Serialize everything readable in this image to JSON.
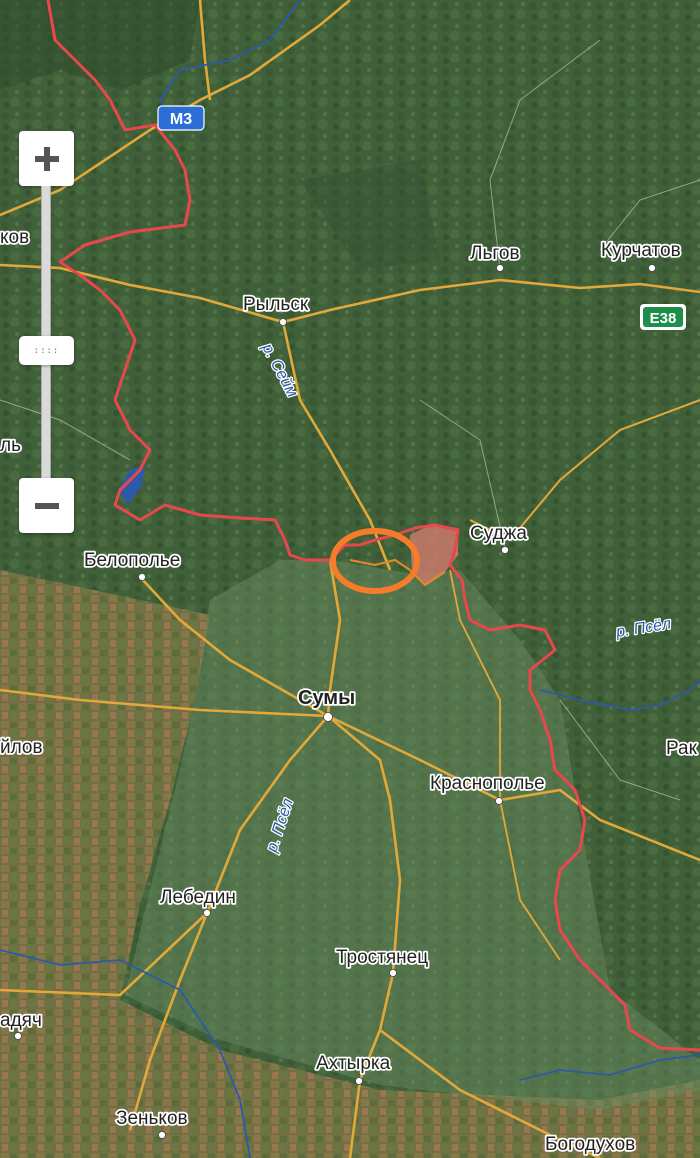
{
  "map": {
    "cities": [
      {
        "id": "lgov",
        "name": "Льгов"
      },
      {
        "id": "kurchatov",
        "name": "Курчатов"
      },
      {
        "id": "rylsk",
        "name": "Рыльск"
      },
      {
        "id": "sudzha",
        "name": "Суджа"
      },
      {
        "id": "belopolye",
        "name": "Белополье"
      },
      {
        "id": "sumy",
        "name": "Сумы"
      },
      {
        "id": "krasnopolye",
        "name": "Краснополье"
      },
      {
        "id": "lebedin",
        "name": "Лебедин"
      },
      {
        "id": "trostyanets",
        "name": "Тростянец"
      },
      {
        "id": "akhtyrka",
        "name": "Ахтырка"
      },
      {
        "id": "zenkov",
        "name": "Зеньков"
      },
      {
        "id": "bogodukhov",
        "name": "Богодухов"
      },
      {
        "id": "partial_kov",
        "name": "ков"
      },
      {
        "id": "partial_l",
        "name": "ль"
      },
      {
        "id": "partial_ilov",
        "name": "йлов"
      },
      {
        "id": "partial_adyach",
        "name": "адяч"
      },
      {
        "id": "partial_rak",
        "name": "Рак"
      }
    ],
    "rivers": [
      {
        "id": "seym",
        "name": "р. Сейм"
      },
      {
        "id": "psel_east",
        "name": "р. Псёл"
      },
      {
        "id": "psel_sumy",
        "name": "р. Псёл"
      }
    ],
    "road_badges": [
      {
        "id": "m3",
        "label": "М3"
      },
      {
        "id": "e38",
        "label": "E38"
      }
    ],
    "colors": {
      "border": "#e8484c",
      "highlight_circle": "#f57c2b",
      "occupied_area": "#c97a6a",
      "roads": "#e2a93a",
      "rivers": "#2c5aa8"
    }
  },
  "zoom_control": {
    "zoom_in_icon": "plus-icon",
    "zoom_out_icon": "minus-icon",
    "handle_label": "::::"
  }
}
